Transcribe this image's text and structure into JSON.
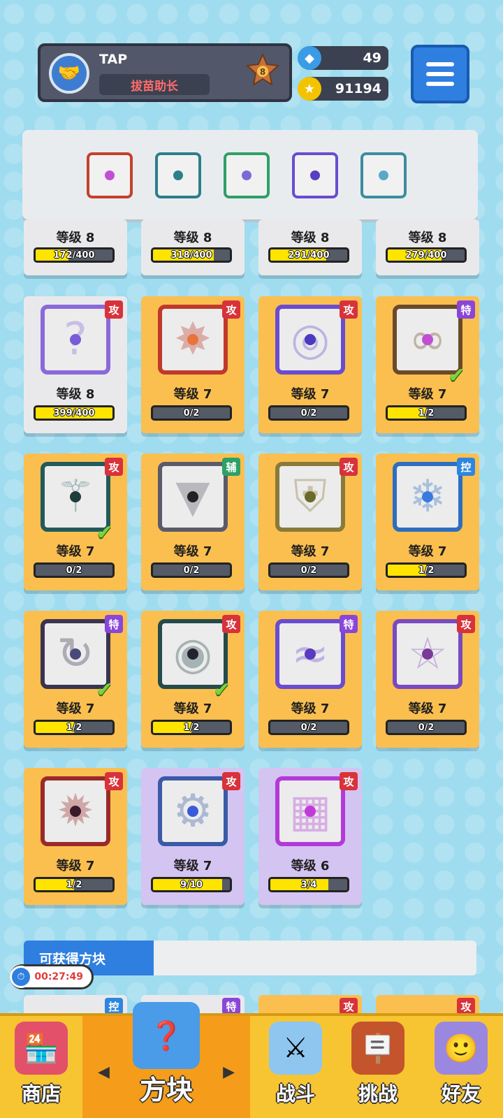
{
  "profile": {
    "name": "TAP",
    "title": "拔苗助长",
    "rank": "8"
  },
  "currency": {
    "gems": "49",
    "coins": "91194"
  },
  "deck": {
    "slots": [
      "rainbow",
      "sword",
      "hands",
      "eye",
      "vortex"
    ]
  },
  "partial_row": [
    {
      "level": "等级 8",
      "progress": "172/400",
      "fill": 0.43
    },
    {
      "level": "等级 8",
      "progress": "318/400",
      "fill": 0.795
    },
    {
      "level": "等级 8",
      "progress": "291/400",
      "fill": 0.73
    },
    {
      "level": "等级 8",
      "progress": "279/400",
      "fill": 0.7
    }
  ],
  "cards": [
    {
      "tag": "攻",
      "level": "等级 8",
      "progress": "399/400",
      "fill": 0.998,
      "style": "white",
      "icon": "question-icon",
      "checked": false
    },
    {
      "tag": "攻",
      "level": "等级 7",
      "progress": "0/2",
      "fill": 0,
      "style": "orange",
      "icon": "sun-icon",
      "checked": false
    },
    {
      "tag": "攻",
      "level": "等级 7",
      "progress": "0/2",
      "fill": 0,
      "style": "orange",
      "icon": "target-icon",
      "checked": false
    },
    {
      "tag": "特",
      "level": "等级 7",
      "progress": "1/2",
      "fill": 0.5,
      "style": "orange",
      "icon": "infinity-icon",
      "checked": true
    },
    {
      "tag": "攻",
      "level": "等级 7",
      "progress": "0/2",
      "fill": 0,
      "style": "orange",
      "icon": "sword-icon",
      "checked": true
    },
    {
      "tag": "辅",
      "level": "等级 7",
      "progress": "0/2",
      "fill": 0,
      "style": "orange",
      "icon": "teeth-icon",
      "checked": false
    },
    {
      "tag": "攻",
      "level": "等级 7",
      "progress": "0/2",
      "fill": 0,
      "style": "orange",
      "icon": "shield-icon",
      "checked": false
    },
    {
      "tag": "控",
      "level": "等级 7",
      "progress": "1/2",
      "fill": 0.5,
      "style": "orange",
      "icon": "snowflake-icon",
      "checked": false
    },
    {
      "tag": "特",
      "level": "等级 7",
      "progress": "1/2",
      "fill": 0.5,
      "style": "orange",
      "icon": "cycle-icon",
      "checked": true
    },
    {
      "tag": "攻",
      "level": "等级 7",
      "progress": "1/2",
      "fill": 0.5,
      "style": "orange",
      "icon": "vortex-icon",
      "checked": true
    },
    {
      "tag": "特",
      "level": "等级 7",
      "progress": "0/2",
      "fill": 0,
      "style": "orange",
      "icon": "wind-icon",
      "checked": false
    },
    {
      "tag": "攻",
      "level": "等级 7",
      "progress": "0/2",
      "fill": 0,
      "style": "orange",
      "icon": "star-icon",
      "checked": false
    },
    {
      "tag": "攻",
      "level": "等级 7",
      "progress": "1/2",
      "fill": 0.5,
      "style": "orange",
      "icon": "saw-icon",
      "checked": false
    },
    {
      "tag": "攻",
      "level": "等级 7",
      "progress": "9/10",
      "fill": 0.9,
      "style": "purple",
      "icon": "gear-icon",
      "checked": false
    },
    {
      "tag": "攻",
      "level": "等级 6",
      "progress": "3/4",
      "fill": 0.75,
      "style": "purple",
      "icon": "pixel-icon",
      "checked": false
    }
  ],
  "available": {
    "title": "可获得方块"
  },
  "available_tags": [
    "控",
    "特",
    "攻",
    "攻"
  ],
  "timer": {
    "value": "00:27:49"
  },
  "nav": {
    "shop": "商店",
    "cubes": "方块",
    "battle": "战斗",
    "challenge": "挑战",
    "friends": "好友"
  }
}
